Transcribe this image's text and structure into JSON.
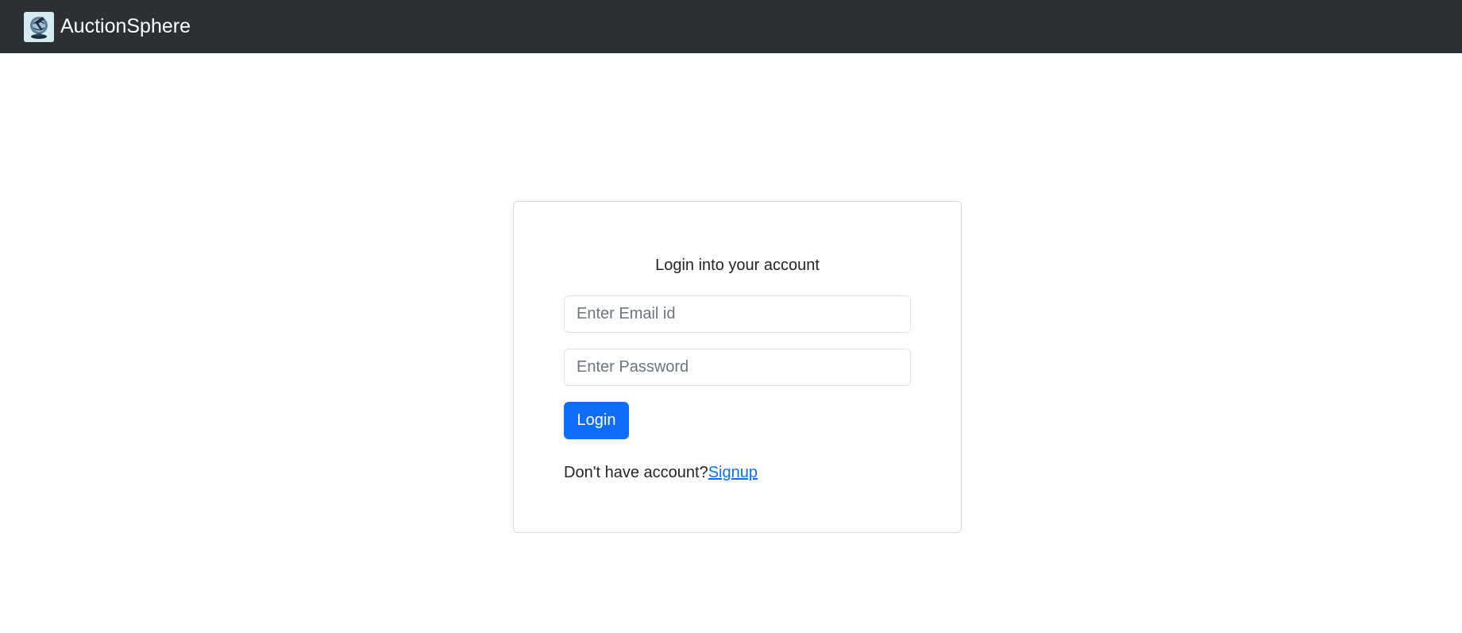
{
  "navbar": {
    "brand_name": "AuctionSphere",
    "logo_icon": "auction-globe-logo-icon",
    "background_color": "#2b3035"
  },
  "login_card": {
    "title": "Login into your account",
    "email_placeholder": "Enter Email id",
    "email_value": "",
    "password_placeholder": "Enter Password",
    "password_value": "",
    "login_label": "Login",
    "signup_prompt": "Don't have account?",
    "signup_link_label": "Signup"
  },
  "colors": {
    "accent": "#0d6efd",
    "card_border": "#d3d6da",
    "text": "#212529"
  }
}
